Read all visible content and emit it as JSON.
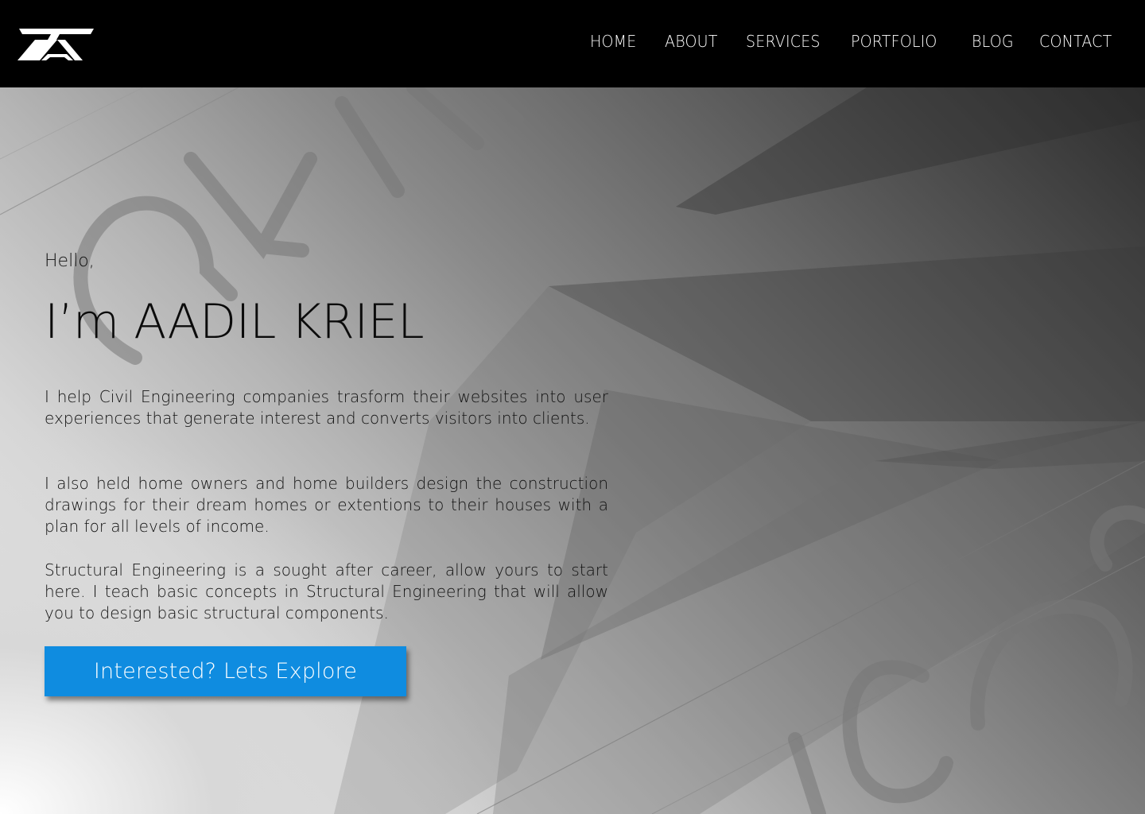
{
  "brand": {
    "logo_icon": "ak-monogram-logo"
  },
  "nav": {
    "items": [
      {
        "label": "HOME"
      },
      {
        "label": "ABOUT"
      },
      {
        "label": "SERVICES"
      },
      {
        "label": "PORTFOLIO"
      },
      {
        "label": "BLOG"
      },
      {
        "label": "CONTACT"
      }
    ]
  },
  "hero": {
    "greeting": "Hello,",
    "title": "I’m AADIL KRIEL",
    "paragraphs": [
      "I help Civil Engineering companies trasform their websites into user experiences that generate interest and converts visitors into clients.",
      "I also held home owners and home builders design the construction drawings for their dream homes or extentions to their houses with a plan for all levels of income.",
      "Structural Engineering is a sought after career, allow yours to start here. I teach basic concepts in Structural Engineering that will allow you to design basic structural components."
    ],
    "cta_label": "Interested? Lets Explore",
    "watermark_top": "AYK",
    "watermark_bottom": "sign"
  },
  "colors": {
    "header_bg": "#000000",
    "nav_text": "#ffffff",
    "cta_bg": "#0f8ce0",
    "cta_text": "#ffffff",
    "body_text": "#111111"
  }
}
